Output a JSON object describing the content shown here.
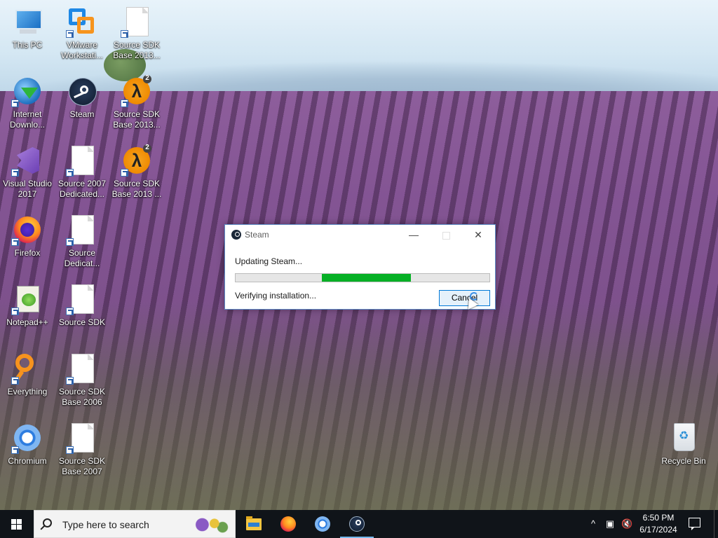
{
  "desktop": {
    "icons": [
      {
        "label": "This PC",
        "icon": "this-pc-icon"
      },
      {
        "label": "VMware Workstati...",
        "icon": "vmware-icon"
      },
      {
        "label": "Source SDK Base 2013...",
        "icon": "document-icon"
      },
      {
        "label": "Internet Downlo...",
        "icon": "internet-download-manager-icon"
      },
      {
        "label": "Steam",
        "icon": "steam-icon"
      },
      {
        "label": "Source SDK Base 2013...",
        "icon": "half-life-2-icon",
        "badge": "2"
      },
      {
        "label": "Visual Studio 2017",
        "icon": "visual-studio-icon"
      },
      {
        "label": "Source 2007 Dedicated...",
        "icon": "document-icon"
      },
      {
        "label": "Source SDK Base 2013 ...",
        "icon": "half-life-2-icon",
        "badge": "2"
      },
      {
        "label": "Firefox",
        "icon": "firefox-icon"
      },
      {
        "label": "Source Dedicat...",
        "icon": "document-icon"
      },
      {
        "label": "Notepad++",
        "icon": "notepad-plus-plus-icon"
      },
      {
        "label": "Source SDK",
        "icon": "document-icon"
      },
      {
        "label": "Everything",
        "icon": "everything-search-icon"
      },
      {
        "label": "Source SDK Base 2006",
        "icon": "document-icon"
      },
      {
        "label": "Chromium",
        "icon": "chromium-icon"
      },
      {
        "label": "Source SDK Base 2007",
        "icon": "document-icon"
      },
      {
        "label": "Recycle Bin",
        "icon": "recycle-bin-icon"
      }
    ]
  },
  "dialog": {
    "title": "Steam",
    "status_line_1": "Updating Steam...",
    "progress": {
      "start_fraction": 0.34,
      "end_fraction": 0.69,
      "color": "#06b025",
      "mode": "indeterminate-marquee"
    },
    "status_line_2": "Verifying installation...",
    "cancel_label": "Cancel",
    "minimize_glyph": "—",
    "close_glyph": "✕"
  },
  "taskbar": {
    "search_placeholder": "Type here to search",
    "pinned": [
      {
        "name": "File Explorer",
        "icon": "file-explorer-icon"
      },
      {
        "name": "Firefox",
        "icon": "firefox-icon"
      },
      {
        "name": "Chromium",
        "icon": "chromium-icon"
      },
      {
        "name": "Steam",
        "icon": "steam-icon",
        "active": true
      }
    ],
    "tray": {
      "chevron": "^",
      "time": "6:50 PM",
      "date": "6/17/2024"
    }
  },
  "colors": {
    "accent": "#0078d7",
    "taskbar_bg": "#101419",
    "progress_fill": "#06b025"
  }
}
